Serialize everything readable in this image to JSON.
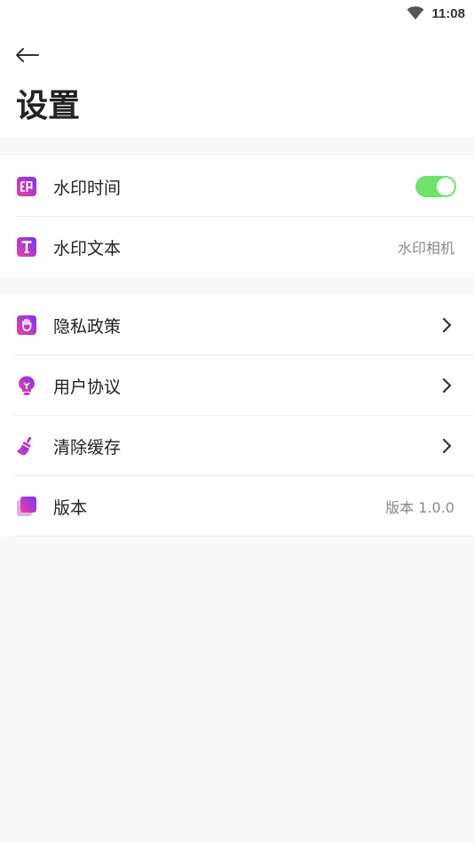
{
  "status_bar": {
    "time": "11:08",
    "wifi_icon": "wifi-icon"
  },
  "header": {
    "back_icon": "arrow-left-icon",
    "title": "设置"
  },
  "colors": {
    "accent_gradient_start": "#ee3fa0",
    "accent_gradient_end": "#7a35f0",
    "toggle_on": "#6ee26b",
    "value_text": "#8a8a8a"
  },
  "settings": {
    "watermark_time": {
      "label": "水印时间",
      "icon": "stamp-icon",
      "toggle_on": true
    },
    "watermark_text": {
      "label": "水印文本",
      "icon": "text-t-icon",
      "value": "水印相机"
    },
    "privacy_policy": {
      "label": "隐私政策",
      "icon": "hand-icon"
    },
    "user_agreement": {
      "label": "用户协议",
      "icon": "lightbulb-icon"
    },
    "clear_cache": {
      "label": "清除缓存",
      "icon": "broom-icon"
    },
    "version": {
      "label": "版本",
      "icon": "layers-icon",
      "value": "版本 1.0.0"
    }
  }
}
